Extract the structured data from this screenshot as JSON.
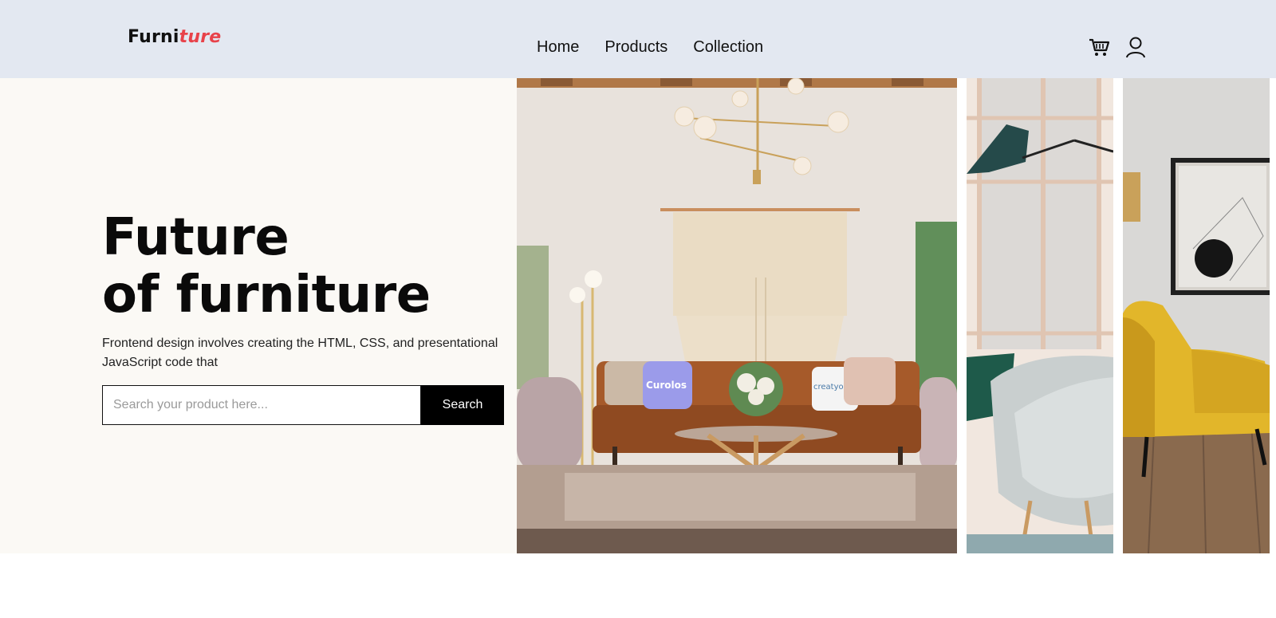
{
  "header": {
    "logo_part1": "Furni",
    "logo_part2": "ture",
    "nav": [
      "Home",
      "Products",
      "Collection"
    ],
    "icons": [
      "cart-icon",
      "user-icon"
    ]
  },
  "hero": {
    "title_line1": "Future",
    "title_line2": "of furniture",
    "description": "Frontend design involves creating the HTML, CSS, and presentational JavaScript code that",
    "search_placeholder": "Search your product here...",
    "search_button": "Search"
  },
  "images": {
    "pillow_left_text": "Curolos",
    "pillow_right_text": "creatyoskin"
  },
  "colors": {
    "header_bg": "#e3e8f1",
    "hero_bg": "#fbf9f5",
    "logo_accent": "#e8424a",
    "button_bg": "#000000"
  }
}
